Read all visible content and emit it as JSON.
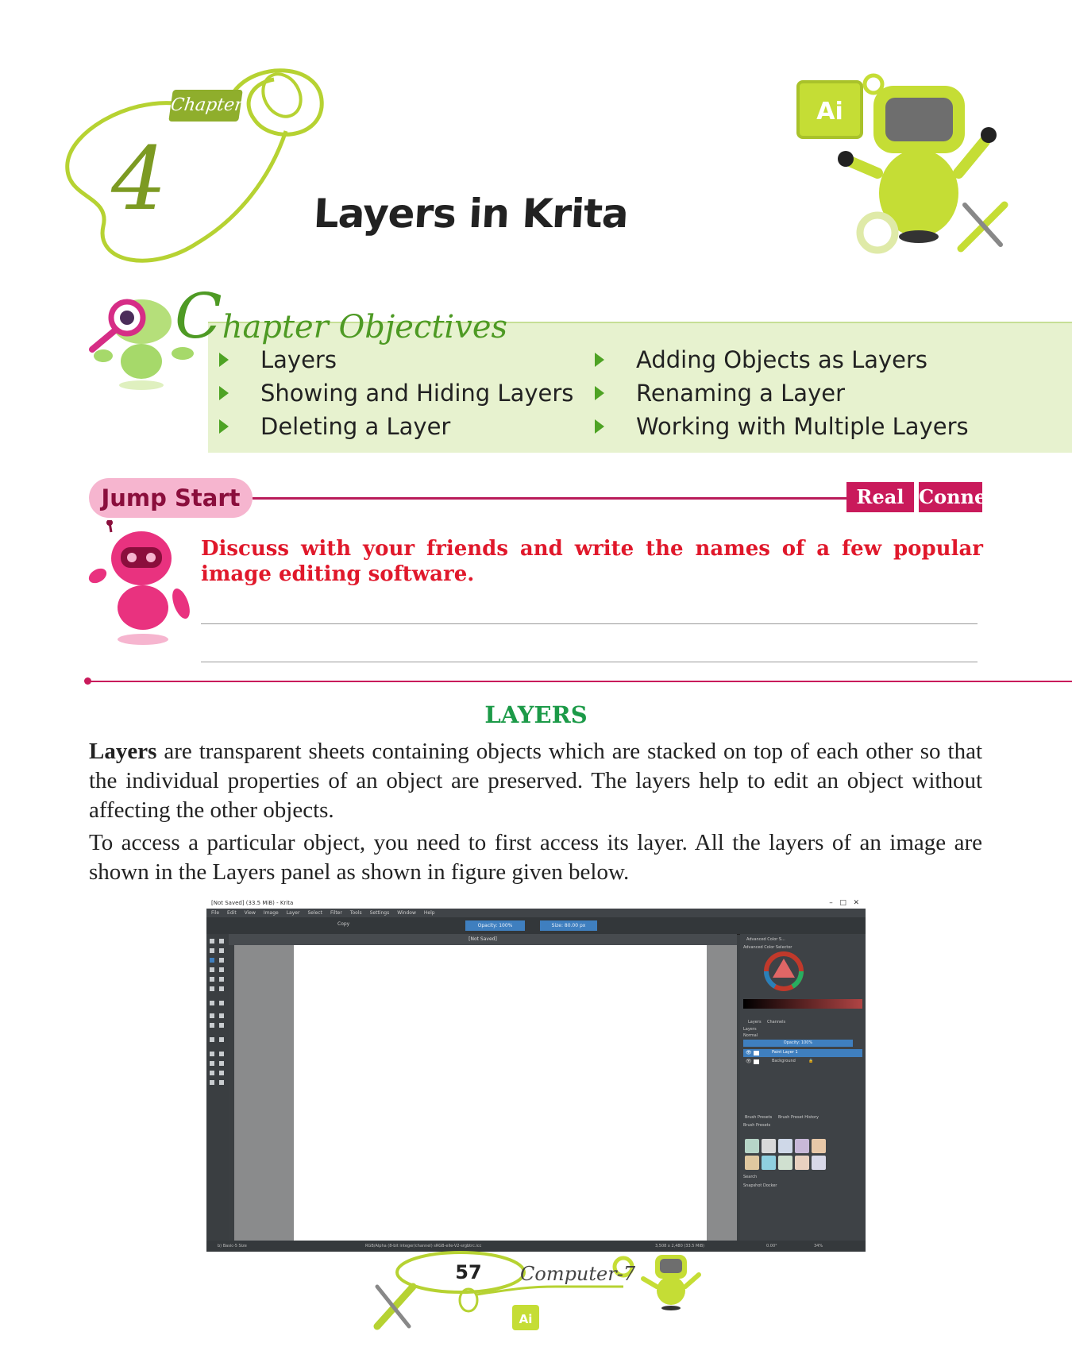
{
  "chapter": {
    "label": "Chapter",
    "number": "4",
    "title": "Layers in Krita"
  },
  "objectives": {
    "title_initial": "C",
    "title_rest": "hapter Objectives",
    "column1": [
      "Layers",
      "Showing and Hiding Layers",
      "Deleting a Layer"
    ],
    "column2": [
      "Adding Objects as Layers",
      "Renaming a Layer",
      "Working with Multiple Layers"
    ]
  },
  "jump_start": {
    "badge": "Jump Start",
    "tag1": "Real Life",
    "tag2": "Connect",
    "question": "Discuss with your friends and write the names of a few popular image editing software."
  },
  "section": {
    "heading": "LAYERS",
    "para1_bold": "Layers",
    "para1_rest": " are transparent sheets containing objects which are stacked on top of each other so that the individual properties of an object are preserved. The layers help to edit an object without affecting the other objects.",
    "para2": "To access a particular object, you need to first access its layer. All the layers of an image are shown in the Layers panel as shown in figure given below."
  },
  "krita": {
    "window_title": "[Not Saved] (33.5 MiB) - Krita",
    "menu": [
      "File",
      "Edit",
      "View",
      "Image",
      "Layer",
      "Select",
      "Filter",
      "Tools",
      "Settings",
      "Window",
      "Help"
    ],
    "blend_mode": "Copy",
    "opacity": "Opacity: 100%",
    "size": "Size: 80.00 px",
    "canvas_tab": "[Not Saved]",
    "dockers": {
      "color_tab": "Advanced Color S...",
      "color_title": "Advanced Color Selector",
      "layers_tab": "Layers",
      "channels_tab": "Channels",
      "layers_title": "Layers",
      "blend": "Normal",
      "layer_opacity": "Opacity: 100%",
      "layers": [
        "Paint Layer 1",
        "Background"
      ],
      "brush_tab": "Brush Presets",
      "history_tab": "Brush Preset History",
      "brush_title": "Brush Presets",
      "search": "Search",
      "snapshot": "Snapshot Docker"
    },
    "status_left": "b) Basic-5 Size",
    "status_mid": "RGB/Alpha (8-bit integer/channel) sRGB-elle-V2-srgbtrc.icc",
    "status_right": "3,508 x 2,480 (33.5 MiB)",
    "zoom": "34%",
    "rotation": "0.00°"
  },
  "colors": {
    "green": "#8fae2c",
    "magenta": "#c91a5b",
    "red_text": "#e0182b",
    "heading_green": "#1c9a48",
    "band": "#e7f2cf"
  },
  "footer": {
    "page_number": "57",
    "label": "Computer-7"
  }
}
